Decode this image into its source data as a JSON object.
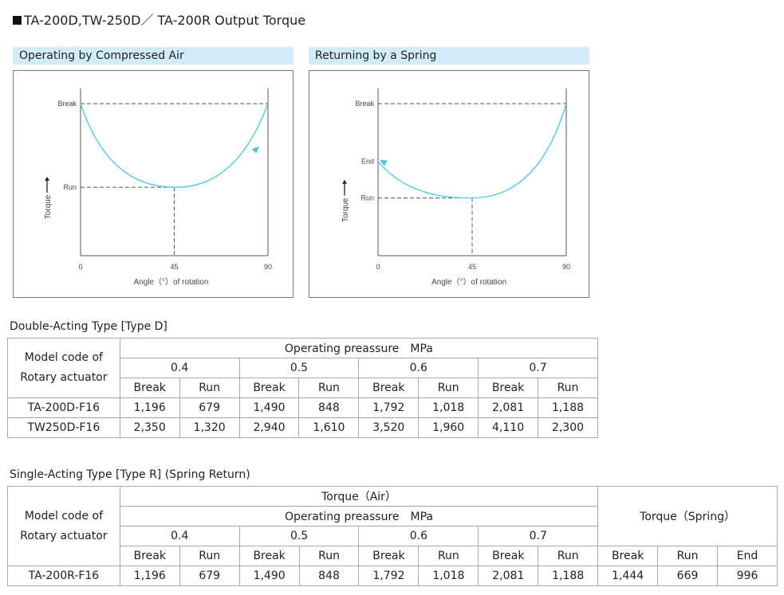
{
  "page_title": "TA-200D,TW-250D／ TA-200R Output Torque",
  "colors": {
    "curve": "#4ec3ea",
    "band": "#d2ecf9",
    "dash": "#555555"
  },
  "chart_data": [
    {
      "type": "line",
      "title": "Operating by Compressed Air",
      "xlabel": "Angle（°）of rotation",
      "ylabel": "Torque",
      "x_ticks": [
        "0",
        "45",
        "90"
      ],
      "y_levels": [
        {
          "label": "Break",
          "value": 1.0
        },
        {
          "label": "Run",
          "value": 0.45
        }
      ],
      "xlim": [
        0,
        90
      ],
      "ylim": [
        0,
        1.1
      ],
      "series": [
        {
          "name": "torque",
          "points": [
            [
              0,
              1.0
            ],
            [
              45,
              0.45
            ],
            [
              90,
              1.0
            ]
          ],
          "arrow_at_x": 85,
          "direction": "forward"
        }
      ]
    },
    {
      "type": "line",
      "title": "Returning by a Spring",
      "xlabel": "Angle（°）of rotation",
      "ylabel": "Torque",
      "x_ticks": [
        "0",
        "45",
        "90"
      ],
      "y_levels": [
        {
          "label": "Break",
          "value": 1.0
        },
        {
          "label": "End",
          "value": 0.62
        },
        {
          "label": "Run",
          "value": 0.38
        }
      ],
      "xlim": [
        0,
        90
      ],
      "ylim": [
        0,
        1.1
      ],
      "series": [
        {
          "name": "torque",
          "points": [
            [
              90,
              1.0
            ],
            [
              45,
              0.38
            ],
            [
              0,
              0.62
            ]
          ],
          "arrow_at_x": 0,
          "direction": "reverse"
        }
      ]
    }
  ],
  "double_acting": {
    "heading": "Double-Acting Type [Type D]",
    "model_header": [
      "Model code of",
      "Rotary actuator"
    ],
    "pressure_header": "Operating preassure　MPa",
    "pressures": [
      "0.4",
      "0.5",
      "0.6",
      "0.7"
    ],
    "sub_headers": [
      "Break",
      "Run"
    ],
    "rows": [
      {
        "model": "TA-200D-F16",
        "values": [
          "1,196",
          "679",
          "1,490",
          "848",
          "1,792",
          "1,018",
          "2,081",
          "1,188"
        ]
      },
      {
        "model": "TW250D-F16",
        "values": [
          "2,350",
          "1,320",
          "2,940",
          "1,610",
          "3,520",
          "1,960",
          "4,110",
          "2,300"
        ]
      }
    ]
  },
  "single_acting": {
    "heading": "Single-Acting Type [Type R] (Spring Return)",
    "model_header": [
      "Model code of",
      "Rotary actuator"
    ],
    "air_header": "Torque（Air）",
    "pressure_header": "Operating preassure　MPa",
    "spring_header": "Torque（Spring）",
    "pressures": [
      "0.4",
      "0.5",
      "0.6",
      "0.7"
    ],
    "sub_headers": [
      "Break",
      "Run"
    ],
    "spring_sub_headers": [
      "Break",
      "Run",
      "End"
    ],
    "rows": [
      {
        "model": "TA-200R-F16",
        "values": [
          "1,196",
          "679",
          "1,490",
          "848",
          "1,792",
          "1,018",
          "2,081",
          "1,188"
        ],
        "spring": [
          "1,444",
          "669",
          "996"
        ]
      }
    ]
  }
}
